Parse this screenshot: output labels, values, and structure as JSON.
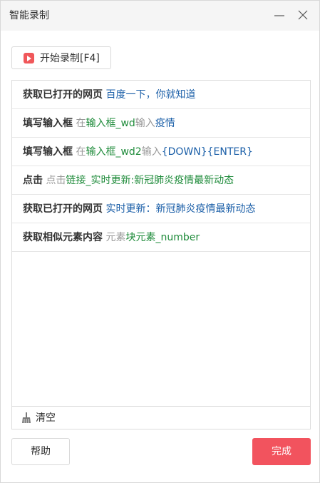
{
  "window": {
    "title": "智能录制",
    "minimize_icon": "minimize-icon",
    "close_icon": "close-icon"
  },
  "toolbar": {
    "record_label": "开始录制[F4]",
    "record_icon": "record-icon"
  },
  "steps": [
    {
      "action": "获取已打开的网页",
      "parts": [
        {
          "text": "百度一下，你就知道",
          "style": "blue"
        }
      ]
    },
    {
      "action": "填写输入框",
      "parts": [
        {
          "text": "在",
          "style": "gray"
        },
        {
          "text": "输入框_wd",
          "style": "green"
        },
        {
          "text": "输入",
          "style": "gray"
        },
        {
          "text": "疫情",
          "style": "blue"
        }
      ]
    },
    {
      "action": "填写输入框",
      "parts": [
        {
          "text": "在",
          "style": "gray"
        },
        {
          "text": "输入框_wd2",
          "style": "green"
        },
        {
          "text": "输入",
          "style": "gray"
        },
        {
          "text": "{DOWN}{ENTER}",
          "style": "blue"
        }
      ]
    },
    {
      "action": "点击",
      "parts": [
        {
          "text": "点击",
          "style": "gray"
        },
        {
          "text": "链接_实时更新:新冠肺炎疫情最新动态",
          "style": "green"
        }
      ]
    },
    {
      "action": "获取已打开的网页",
      "parts": [
        {
          "text": "实时更新：新冠肺炎疫情最新动态",
          "style": "blue"
        }
      ]
    },
    {
      "action": "获取相似元素内容",
      "parts": [
        {
          "text": "元素",
          "style": "gray"
        },
        {
          "text": "块元素_number",
          "style": "green"
        }
      ]
    }
  ],
  "footer": {
    "clear_label": "清空",
    "clear_icon": "broom-icon"
  },
  "buttons": {
    "help_label": "帮助",
    "done_label": "完成"
  },
  "colors": {
    "accent": "#f2535e",
    "record_icon": "#f0575a",
    "link_blue": "#1b5fa8",
    "element_green": "#1e8b3a",
    "muted_gray": "#999999"
  }
}
